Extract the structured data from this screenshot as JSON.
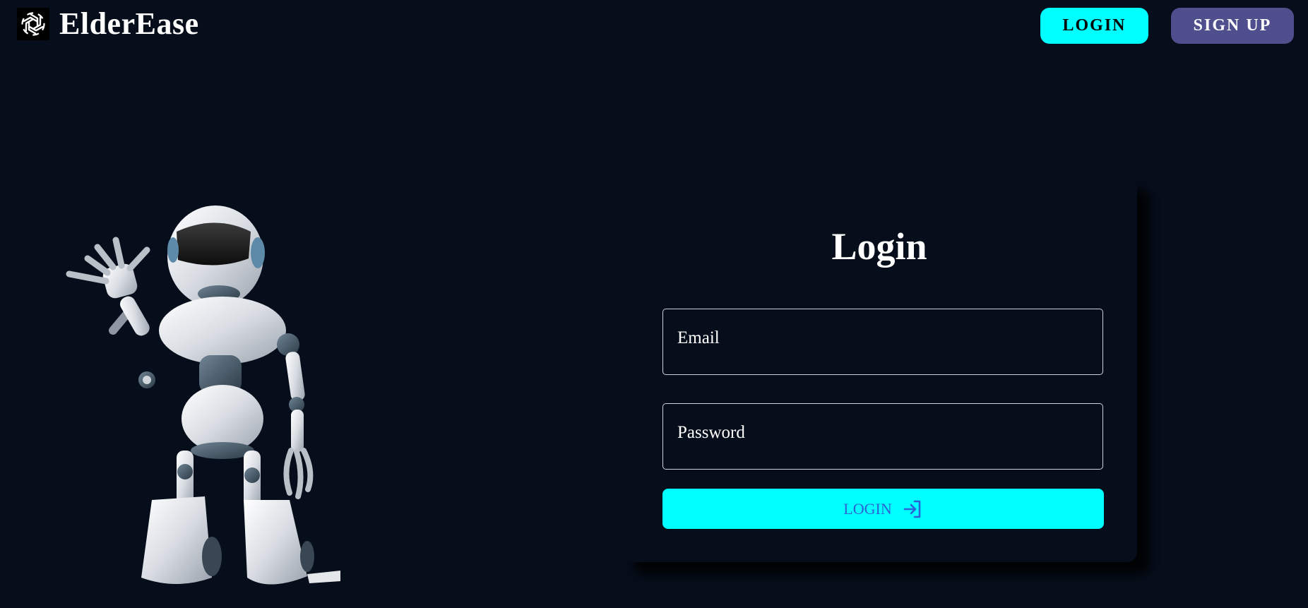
{
  "app": {
    "name": "ElderEase",
    "logo_icon": "openai-knot-icon"
  },
  "nav": {
    "login_label": "LOGIN",
    "signup_label": "SIGN UP"
  },
  "illustration": {
    "icon": "waving-robot-illustration"
  },
  "login_form": {
    "title": "Login",
    "email_placeholder": "Email",
    "password_placeholder": "Password",
    "submit_label": "LOGIN",
    "submit_icon": "sign-in-arrow-icon"
  },
  "colors": {
    "background": "#060e1b",
    "accent": "#00ffff",
    "signup_button": "#4f4f8e",
    "submit_text": "#2a64d6"
  }
}
